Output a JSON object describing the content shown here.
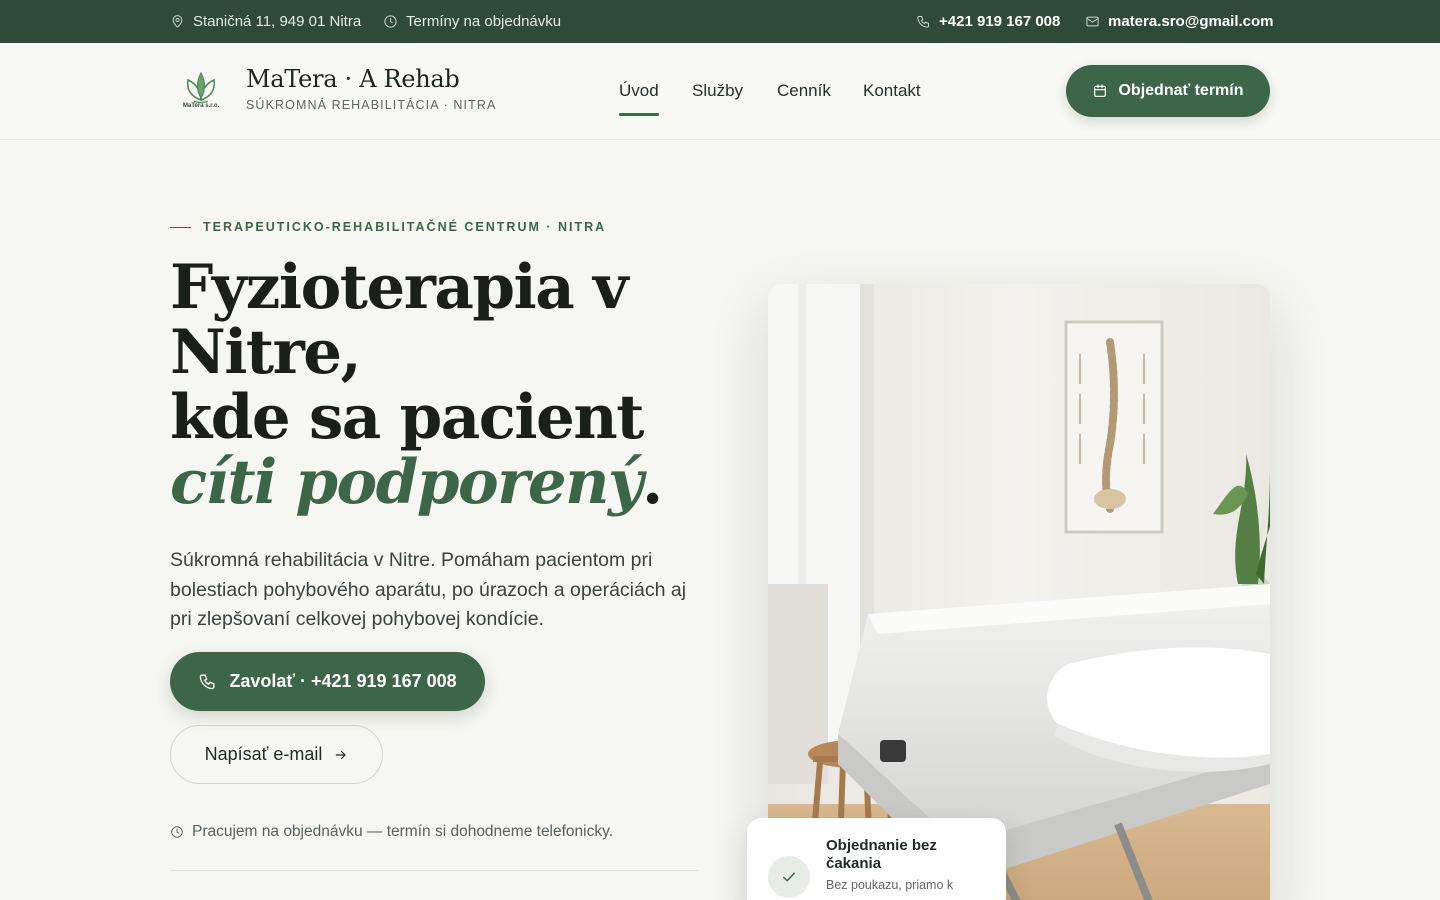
{
  "topbar": {
    "address": "Staničná 11, 949 01 Nitra",
    "hours": "Termíny na objednávku",
    "phone": "+421 919 167 008",
    "email": "matera.sro@gmail.com"
  },
  "brand": {
    "name": "MaTera · A Rehab",
    "subtitle": "SÚKROMNÁ REHABILITÁCIA · NITRA",
    "logo_text": "MaTera s.r.o."
  },
  "nav": {
    "items": [
      {
        "label": "Úvod",
        "active": true
      },
      {
        "label": "Služby",
        "active": false
      },
      {
        "label": "Cenník",
        "active": false
      },
      {
        "label": "Kontakt",
        "active": false
      }
    ],
    "cta_label": "Objednať termín"
  },
  "hero": {
    "eyebrow": "TERAPEUTICKO-REHABILITAČNÉ CENTRUM · NITRA",
    "headline_line1": "Fyzioterapia v Nitre,",
    "headline_line2_plain": "kde sa pacient ",
    "headline_accent": "cíti podporený",
    "headline_end": ".",
    "lead": "Súkromná rehabilitácia v Nitre. Pomáham pacientom pri bolestiach pohybového aparátu, po úrazoch a operáciách aj pri zlepšovaní celkovej pohybovej kondície.",
    "call_label": "Zavolať · +421 919 167 008",
    "email_label": "Napísať e-mail",
    "note": "Pracujem na objednávku — termín si dohodneme telefonicky."
  },
  "badge": {
    "title": "Objednanie bez čakania",
    "subtitle": "Bez poukazu, priamo k"
  },
  "icons": {
    "address": "map-pin-icon",
    "hours": "clock-icon",
    "phone": "phone-icon",
    "email": "mail-icon",
    "calendar": "calendar-icon",
    "arrow": "arrow-right-icon",
    "check": "check-icon"
  },
  "colors": {
    "primary": "#3d6649",
    "topbar": "#2f4a38",
    "background": "#f6f6f2"
  }
}
